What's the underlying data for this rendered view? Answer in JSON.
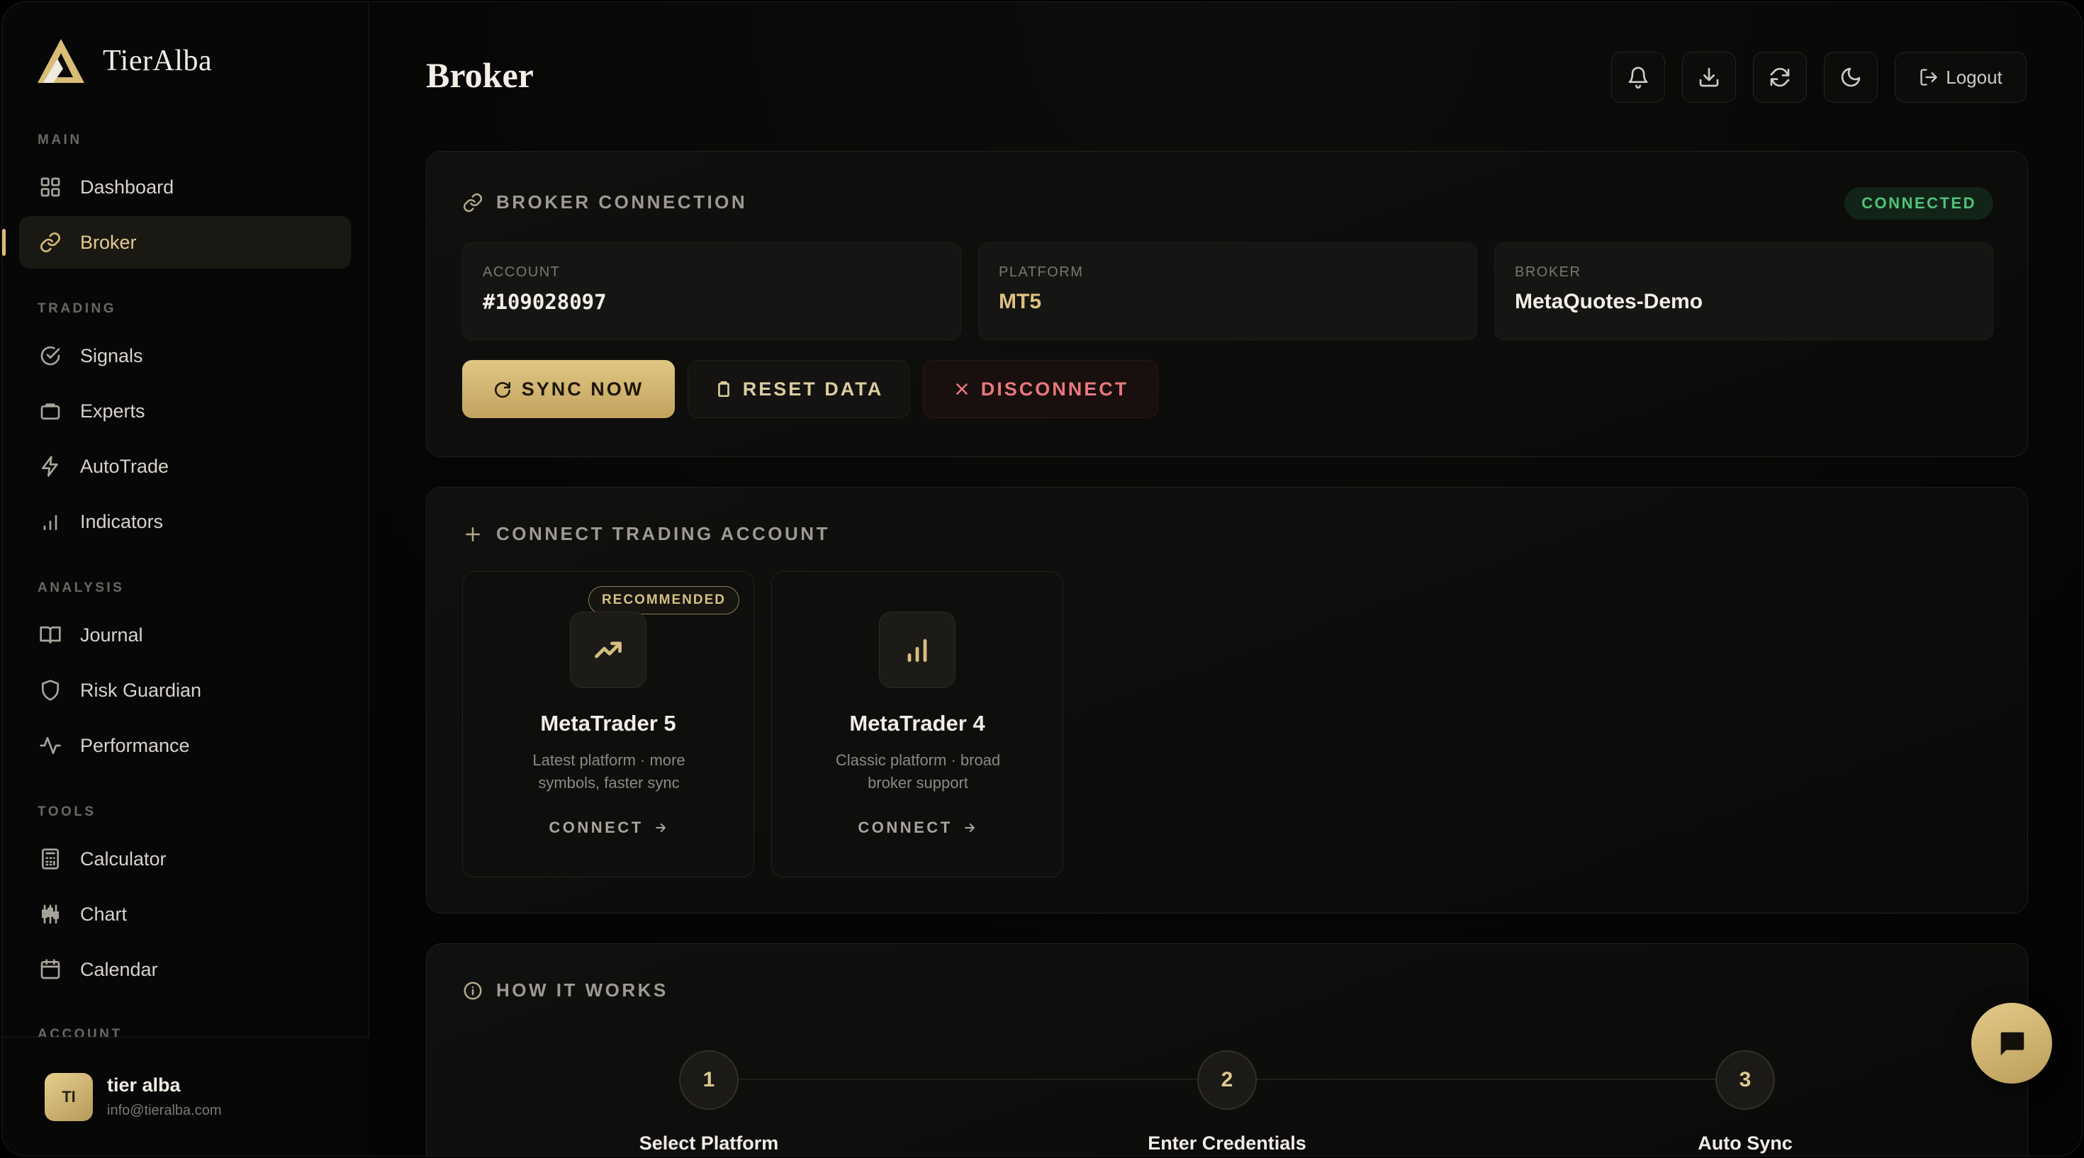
{
  "brand": {
    "name": "TierAlba"
  },
  "sidebar": {
    "sections": {
      "main": "MAIN",
      "trading": "TRADING",
      "analysis": "ANALYSIS",
      "tools": "TOOLS",
      "account": "ACCOUNT"
    },
    "items": {
      "dashboard": "Dashboard",
      "broker": "Broker",
      "signals": "Signals",
      "experts": "Experts",
      "autotrade": "AutoTrade",
      "indicators": "Indicators",
      "journal": "Journal",
      "risk_guardian": "Risk Guardian",
      "performance": "Performance",
      "calculator": "Calculator",
      "chart": "Chart",
      "calendar": "Calendar"
    },
    "active": "broker"
  },
  "user": {
    "initials": "TI",
    "name": "tier alba",
    "email": "info@tieralba.com"
  },
  "header": {
    "title": "Broker",
    "logout_label": "Logout"
  },
  "connection": {
    "title": "BROKER CONNECTION",
    "status": "CONNECTED",
    "account_label": "ACCOUNT",
    "account_value": "#109028097",
    "platform_label": "PLATFORM",
    "platform_value": "MT5",
    "broker_label": "BROKER",
    "broker_value": "MetaQuotes-Demo",
    "sync_label": "SYNC NOW",
    "reset_label": "RESET DATA",
    "disconnect_label": "DISCONNECT"
  },
  "connect_account": {
    "title": "CONNECT TRADING ACCOUNT",
    "platforms": [
      {
        "badge": "RECOMMENDED",
        "name": "MetaTrader 5",
        "desc": "Latest platform · more symbols, faster sync",
        "action": "CONNECT",
        "icon": "trending-up-icon"
      },
      {
        "badge": "",
        "name": "MetaTrader 4",
        "desc": "Classic platform · broad broker support",
        "action": "CONNECT",
        "icon": "bar-chart-icon"
      }
    ]
  },
  "how_it_works": {
    "title": "HOW IT WORKS",
    "steps": [
      {
        "number": "1",
        "label": "Select Platform"
      },
      {
        "number": "2",
        "label": "Enter Credentials"
      },
      {
        "number": "3",
        "label": "Auto Sync"
      }
    ]
  },
  "colors": {
    "accent": "#d8bd78",
    "connected": "#4fc37a",
    "danger": "#e8787a",
    "background": "#050505"
  }
}
